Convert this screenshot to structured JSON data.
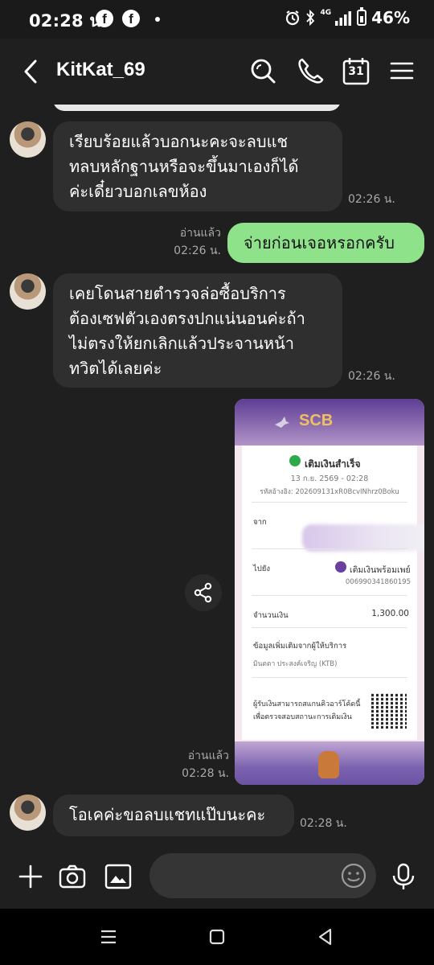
{
  "status_bar": {
    "time": "02:28 น.",
    "notif_icons": [
      "facebook-icon",
      "facebook-icon"
    ],
    "network": "4G",
    "battery": "46%"
  },
  "header": {
    "back_icon": "chevron-left-icon",
    "title": "KitKat_69",
    "actions": [
      "search-icon",
      "phone-icon",
      "calendar-icon",
      "menu-icon"
    ],
    "calendar_day": "31"
  },
  "messages": [
    {
      "side": "in",
      "text_lines": [
        "เรียบร้อยแล้วบอกนะคะจะลบแช",
        "ทลบหลักฐานหรือจะขึ้นมาเองก็ได้",
        "ค่ะเดี๋ยวบอกเลขห้อง"
      ],
      "time": "02:26 น."
    },
    {
      "side": "out",
      "text": "จ่ายก่อนเจอหรอกครับ",
      "read": "อ่านแล้ว",
      "time": "02:26 น."
    },
    {
      "side": "in",
      "text_lines": [
        "เคยโดนสายตำรวจล่อซื้อบริการ",
        "ต้องเซฟตัวเองตรงปกแน่นอนค่ะถ้า",
        "ไม่ตรงให้ยกเลิกแล้วประจานหน้า",
        "ทวิตได้เลยค่ะ"
      ],
      "time": "02:26 น."
    },
    {
      "side": "out",
      "type": "image",
      "read": "อ่านแล้ว",
      "time": "02:28 น.",
      "slip": {
        "logo": "SCB",
        "status": "เติมเงินสำเร็จ",
        "date": "13 ก.ย. 2569 - 02:28",
        "ref": "รหัสอ้างอิง: 202609131xR0BcvINhrz0Boku",
        "from_label": "จาก",
        "to_label": "ไปยัง",
        "to_name": "เติมเงินพร้อมเพย์",
        "to_account": "006990341860195",
        "amount_label": "จำนวนเงิน",
        "amount": "1,300.00",
        "extra_label": "ข้อมูลเพิ่มเติมจากผู้ให้บริการ",
        "extra_value": "มินตตา ประสงค์เจริญ (KTB)",
        "qr_note_1": "ผู้รับเงินสามารถสแกนคิวอาร์โค้ดนี้",
        "qr_note_2": "เพื่อตรวจสอบสถานะการเติมเงิน"
      }
    },
    {
      "side": "in",
      "text": "โอเคค่ะขอลบแชทแป๊บนะคะ",
      "time": "02:28 น."
    }
  ],
  "input_bar": {
    "icons": [
      "plus-icon",
      "camera-icon",
      "image-icon",
      "emoji-icon",
      "microphone-icon"
    ],
    "placeholder": ""
  },
  "nav_bar": [
    "recents-icon",
    "home-icon",
    "back-icon"
  ]
}
